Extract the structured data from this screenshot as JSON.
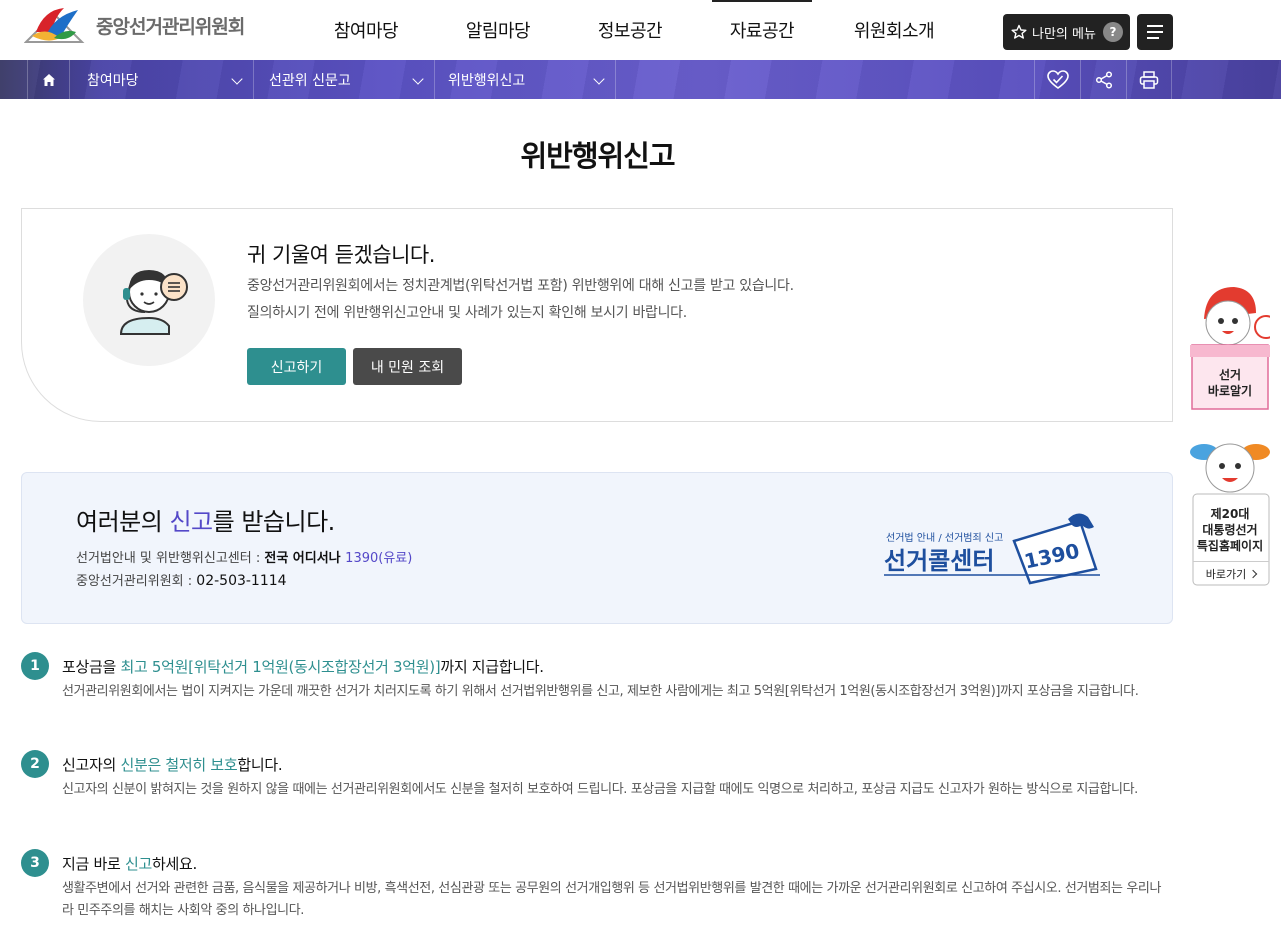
{
  "header": {
    "logo_text": "중앙선거관리위원회",
    "nav": [
      "참여마당",
      "알림마당",
      "정보공간",
      "자료공간",
      "위원회소개"
    ],
    "my_menu_label": "나만의 메뉴",
    "help_badge": "?"
  },
  "breadcrumb": {
    "level1": "참여마당",
    "level2": "선관위 신문고",
    "level3": "위반행위신고"
  },
  "page": {
    "title": "위반행위신고"
  },
  "intro": {
    "heading": "귀 기울여 듣겠습니다.",
    "line1": "중앙선거관리위원회에서는 정치관계법(위탁선거법 포함) 위반행위에 대해 신고를 받고 있습니다.",
    "line2": "질의하시기 전에 위반행위신고안내 및 사례가 있는지 확인해 보시기 바랍니다.",
    "report_button": "신고하기",
    "lookup_button": "내 민원 조회"
  },
  "callcenter": {
    "heading_pre": "여러분의 ",
    "heading_hl": "신고",
    "heading_post": "를 받습니다.",
    "line1_label": "선거법안내 및 위반행위신고센터 : ",
    "line1_strong": "전국 어디서나 ",
    "line1_number": "1390(유료)",
    "line2_label": "중앙선거관리위원회 : ",
    "line2_value": "02-503-1114",
    "logo_small": "선거법 안내 / 선거범죄 신고",
    "logo_main": "선거콜센터",
    "logo_number": "1390"
  },
  "items": [
    {
      "num": "1",
      "title_pre": "포상금을 ",
      "title_hl": "최고 5억원[위탁선거 1억원(동시조합장선거 3억원)]",
      "title_post": "까지 지급합니다.",
      "desc": "선거관리위원회에서는 법이 지켜지는 가운데 깨끗한 선거가 치러지도록 하기 위해서 선거법위반행위를 신고, 제보한 사람에게는 최고 5억원[위탁선거 1억원(동시조합장선거 3억원)]까지 포상금을 지급합니다."
    },
    {
      "num": "2",
      "title_pre": "신고자의 ",
      "title_hl": "신분은 철저히 보호",
      "title_post": "합니다.",
      "desc": "신고자의 신분이 밝혀지는 것을 원하지 않을 때에는 선거관리위원회에서도 신분을 철저히 보호하여 드립니다. 포상금을 지급할 때에도 익명으로 처리하고, 포상금 지급도 신고자가 원하는 방식으로 지급합니다."
    },
    {
      "num": "3",
      "title_pre": "지금 바로 ",
      "title_hl": "신고",
      "title_post": "하세요.",
      "desc": "생활주변에서 선거와 관련한 금품, 음식물을 제공하거나 비방, 흑색선전, 선심관광 또는 공무원의 선거개입행위 등 선거법위반행위를 발견한 때에는 가까운 선거관리위원회로 신고하여 주십시오. 선거범죄는 우리나라 민주주의를 해치는 사회악 중의 하나입니다."
    }
  ],
  "side": {
    "banner1": [
      "선거",
      "바로알기"
    ],
    "banner2": [
      "제20대",
      "대통령선거",
      "특집홈페이지"
    ],
    "banner2_go": "바로가기"
  },
  "colors": {
    "accent_teal": "#2e8f8f",
    "accent_purple": "#5448c8",
    "dark_button": "#4a4a4a"
  },
  "icons": [
    "home-icon",
    "chevron-down-icon",
    "heart-check-icon",
    "share-icon",
    "print-icon",
    "star-icon",
    "hamburger-icon",
    "counselor-icon",
    "chevron-right-icon"
  ]
}
